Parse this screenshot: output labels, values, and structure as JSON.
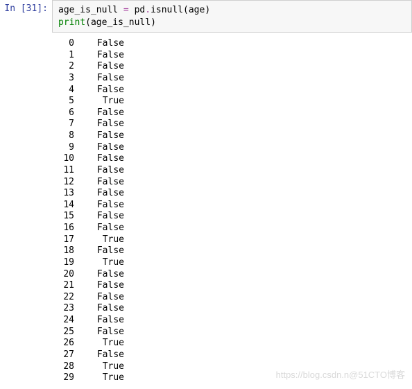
{
  "prompt": {
    "label": "In ",
    "number": "[31]:"
  },
  "code": {
    "line1": {
      "lhs": "age_is_null",
      "eq": " = ",
      "rhs1": "pd",
      "dot": ".",
      "rhs2": "isnull",
      "p1": "(",
      "arg": "age",
      "p2": ")"
    },
    "line2": {
      "fn": "print",
      "p1": "(",
      "arg": "age_is_null",
      "p2": ")"
    }
  },
  "output_rows": [
    {
      "idx": "0",
      "val": "False"
    },
    {
      "idx": "1",
      "val": "False"
    },
    {
      "idx": "2",
      "val": "False"
    },
    {
      "idx": "3",
      "val": "False"
    },
    {
      "idx": "4",
      "val": "False"
    },
    {
      "idx": "5",
      "val": "True"
    },
    {
      "idx": "6",
      "val": "False"
    },
    {
      "idx": "7",
      "val": "False"
    },
    {
      "idx": "8",
      "val": "False"
    },
    {
      "idx": "9",
      "val": "False"
    },
    {
      "idx": "10",
      "val": "False"
    },
    {
      "idx": "11",
      "val": "False"
    },
    {
      "idx": "12",
      "val": "False"
    },
    {
      "idx": "13",
      "val": "False"
    },
    {
      "idx": "14",
      "val": "False"
    },
    {
      "idx": "15",
      "val": "False"
    },
    {
      "idx": "16",
      "val": "False"
    },
    {
      "idx": "17",
      "val": "True"
    },
    {
      "idx": "18",
      "val": "False"
    },
    {
      "idx": "19",
      "val": "True"
    },
    {
      "idx": "20",
      "val": "False"
    },
    {
      "idx": "21",
      "val": "False"
    },
    {
      "idx": "22",
      "val": "False"
    },
    {
      "idx": "23",
      "val": "False"
    },
    {
      "idx": "24",
      "val": "False"
    },
    {
      "idx": "25",
      "val": "False"
    },
    {
      "idx": "26",
      "val": "True"
    },
    {
      "idx": "27",
      "val": "False"
    },
    {
      "idx": "28",
      "val": "True"
    },
    {
      "idx": "29",
      "val": "True"
    }
  ],
  "watermark": "https://blog.csdn.n@51CTO博客"
}
